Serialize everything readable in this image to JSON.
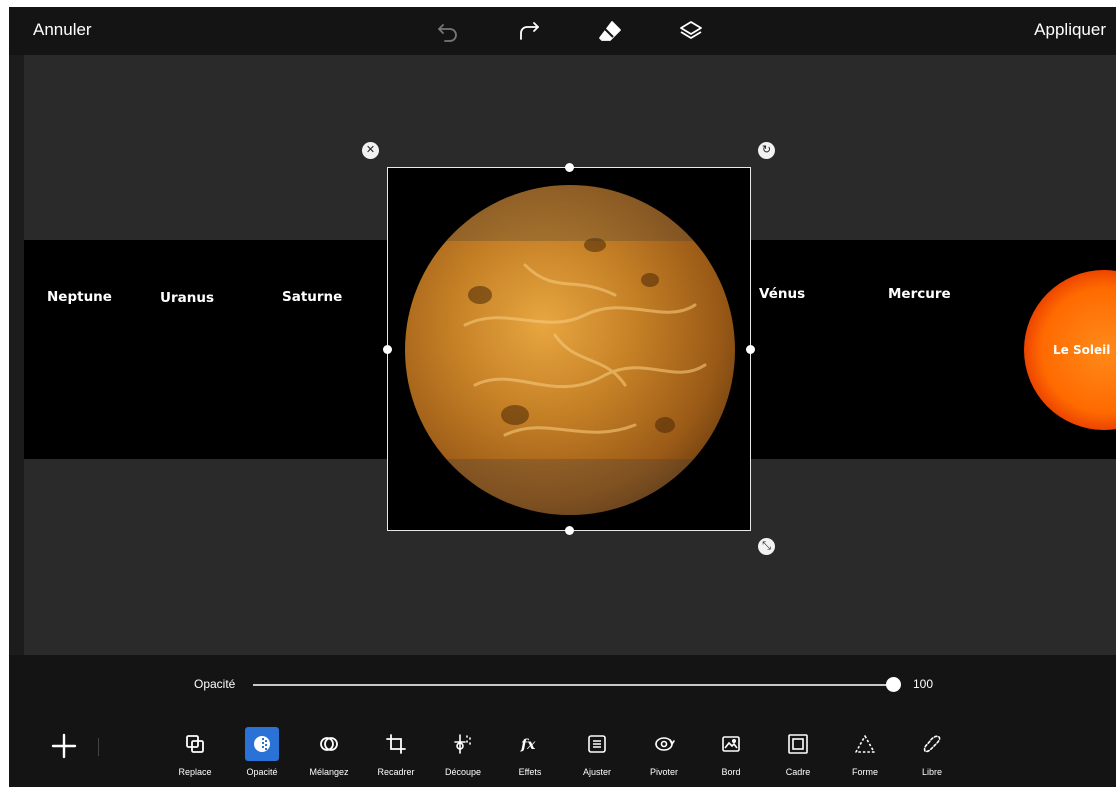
{
  "topbar": {
    "cancel_label": "Annuler",
    "apply_label": "Appliquer",
    "icons": [
      "undo-icon",
      "redo-icon",
      "eraser-icon",
      "layers-icon"
    ]
  },
  "canvas": {
    "planets": [
      "Neptune",
      "Uranus",
      "Saturne",
      "Vénus",
      "Mercure"
    ],
    "sun_label": "Le Soleil"
  },
  "opacity": {
    "label": "Opacité",
    "value": "100",
    "fraction": 1.0
  },
  "toolbar": {
    "add_icon": "plus-icon",
    "tools": [
      {
        "label": "Replace",
        "icon": "replace-icon"
      },
      {
        "label": "Opacité",
        "icon": "opacity-icon",
        "active": true
      },
      {
        "label": "Mélangez",
        "icon": "blend-icon"
      },
      {
        "label": "Recadrer",
        "icon": "crop-icon"
      },
      {
        "label": "Découpe",
        "icon": "cutout-icon"
      },
      {
        "label": "Effets",
        "icon": "fx-icon"
      },
      {
        "label": "Ajuster",
        "icon": "adjust-icon"
      },
      {
        "label": "Pivoter",
        "icon": "rotate-icon"
      },
      {
        "label": "Bord",
        "icon": "border-icon"
      },
      {
        "label": "Cadre",
        "icon": "frame-icon"
      },
      {
        "label": "Forme",
        "icon": "shape-icon"
      },
      {
        "label": "Libre",
        "icon": "freeform-icon"
      }
    ],
    "accent_color": "#2b72d6"
  }
}
